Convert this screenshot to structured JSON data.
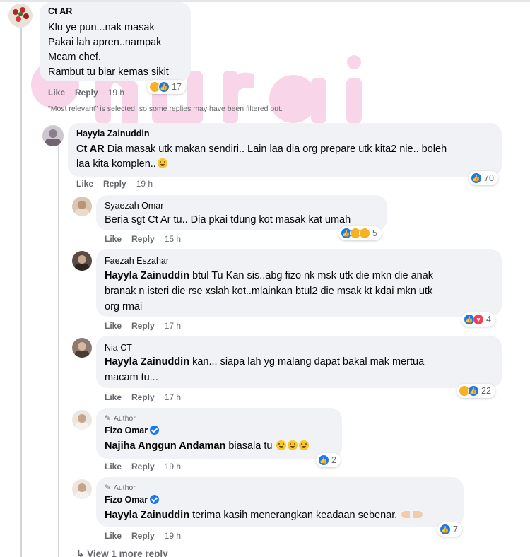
{
  "labels": {
    "like": "Like",
    "reply": "Reply",
    "author": "Author"
  },
  "notice": "\"Most relevant\" is selected, so some replies may have been filtered out.",
  "view_more": "View 1 more reply",
  "colors": {
    "like_blue": "#1877f2",
    "bubble": "#f0f2f5",
    "meta_gray": "#65676b",
    "watermark": "#e0007a"
  },
  "comments": [
    {
      "name": "Ct AR",
      "lines": [
        "Klu ye pun...nak masak",
        "Pakai lah apren..nampak",
        "Mcam chef.",
        "Rambut tu biar kemas sikit"
      ],
      "time": "19 h",
      "reactions": [
        "haha",
        "like"
      ],
      "reaction_count": "17"
    },
    {
      "name": "Hayyla Zainuddin",
      "mention": "Ct AR",
      "line1": " Dia masak utk makan sendiri.. Lain laa dia org prepare utk kita2 nie.. boleh",
      "line2": "laa kita komplen..",
      "time": "19 h",
      "reactions": [
        "like"
      ],
      "reaction_count": "70"
    },
    {
      "name": "Syaezah Omar",
      "line1": "Beria sgt Ct Ar tu.. Dia pkai tdung kot masak kat umah",
      "time": "15 h",
      "reactions": [
        "like",
        "haha",
        "sad"
      ],
      "reaction_count": "5"
    },
    {
      "name": "Faezah Eszahar",
      "mention": "Hayyla Zainuddin",
      "line1": " btul Tu Kan sis..abg fizo nk msk utk die mkn die anak",
      "line2": "branak n isteri die rse xslah kot..mlainkan btul2 die msak kt kdai mkn utk",
      "line3": "org rmai",
      "time": "17 h",
      "reactions": [
        "like",
        "love"
      ],
      "reaction_count": "4"
    },
    {
      "name": "Nia CT",
      "mention": "Hayyla Zainuddin",
      "line1": " kan... siapa lah yg malang dapat bakal mak mertua",
      "line2": "macam tu...",
      "time": "17 h",
      "reactions": [
        "haha",
        "like"
      ],
      "reaction_count": "22"
    },
    {
      "name": "Fizo Omar",
      "verified": true,
      "mention": "Najiha Anggun Andaman",
      "line1": " biasala tu",
      "time": "19 h",
      "reactions": [
        "like"
      ],
      "reaction_count": "2"
    },
    {
      "name": "Fizo Omar",
      "verified": true,
      "mention": "Hayyla Zainuddin",
      "line1": " terima kasih menerangkan keadaan sebenar.",
      "time": "19 h",
      "reactions": [
        "like"
      ],
      "reaction_count": "7"
    }
  ]
}
